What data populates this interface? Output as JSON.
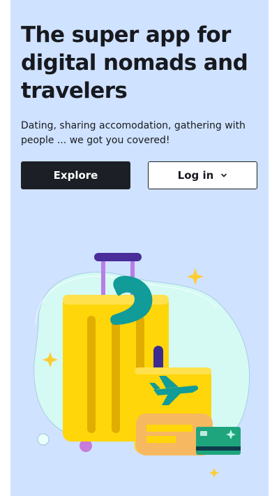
{
  "hero": {
    "title": "The super app for digital nomads and travelers",
    "subtitle": "Dating, sharing accomodation, gathering with people ... we got you covered!"
  },
  "actions": {
    "explore_label": "Explore",
    "login_label": "Log in",
    "login_icon": "chevron-down-icon"
  },
  "illustration": {
    "name": "travel-luggage-illustration",
    "icons": [
      "suitcase-icon",
      "airplane-icon",
      "credit-card-icon",
      "neck-pillow-icon",
      "sparkle-icon"
    ]
  },
  "colors": {
    "background": "#cfe2ff",
    "primary_button": "#1c1f26",
    "text": "#17191f",
    "suitcase": "#ffd60a",
    "accent_teal": "#13999a"
  }
}
